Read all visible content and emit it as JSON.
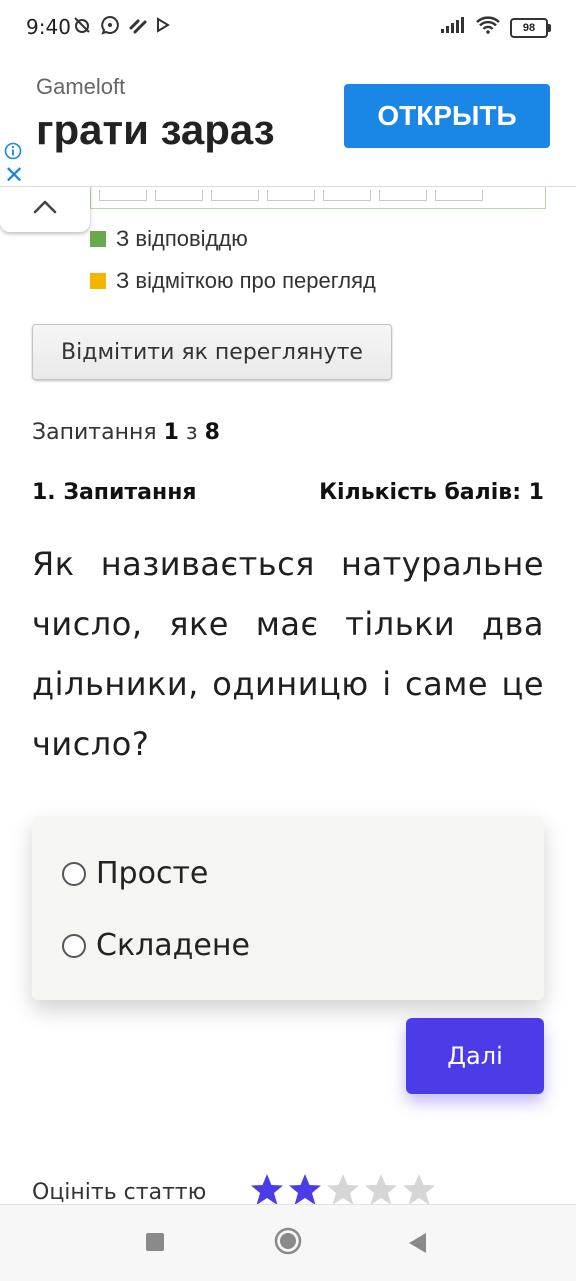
{
  "status_bar": {
    "time": "9:40",
    "battery": "98"
  },
  "ad": {
    "brand": "Gameloft",
    "headline": "грати зараз",
    "cta": "ОТКРЫТЬ",
    "close_glyph": "✕"
  },
  "legend": {
    "answered": {
      "label": "З відповіддю",
      "color": "#6aa84f"
    },
    "marked": {
      "label": "З відміткою про перегляд",
      "color": "#f5b400"
    }
  },
  "mark_button": "Відмітити як переглянуте",
  "counter": {
    "prefix": "Запитання",
    "current": "1",
    "separator": "з",
    "total": "8"
  },
  "question": {
    "title": "1. Запитання",
    "points": "Кількість балів: 1",
    "text": "Як називається натуральне число, яке має тільки два дільники, одиницю і саме це число?",
    "options": [
      "Просте",
      "Складене"
    ]
  },
  "next_button": "Далі",
  "rating": {
    "label": "Оцініть статтю",
    "value": 2,
    "max": 5,
    "active_color": "#4b3ce8",
    "inactive_color": "#d6d6d6"
  },
  "colors": {
    "accent": "#4b3ce8",
    "ad_cta": "#1a87e6"
  }
}
